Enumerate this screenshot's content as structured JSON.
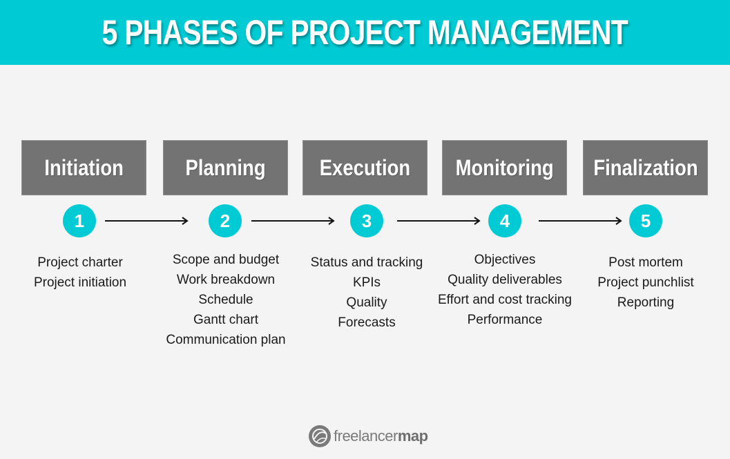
{
  "title": "5 PHASES OF PROJECT MANAGEMENT",
  "colors": {
    "accent": "#00cbd4",
    "box": "#737373",
    "background": "#f4f4f4"
  },
  "phases": [
    {
      "name": "Initiation",
      "number": "1",
      "items": [
        "Project charter",
        "Project initiation"
      ]
    },
    {
      "name": "Planning",
      "number": "2",
      "items": [
        "Scope and budget",
        "Work breakdown",
        "Schedule",
        "Gantt chart",
        "Communication plan"
      ]
    },
    {
      "name": "Execution",
      "number": "3",
      "items": [
        "Status and tracking",
        "KPIs",
        "Quality",
        "Forecasts"
      ]
    },
    {
      "name": "Monitoring",
      "number": "4",
      "items": [
        "Objectives",
        "Quality deliverables",
        "Effort and cost tracking",
        "Performance"
      ]
    },
    {
      "name": "Finalization",
      "number": "5",
      "items": [
        "Post mortem",
        "Project punchlist",
        "Reporting"
      ]
    }
  ],
  "logo": {
    "light": "freelancer",
    "bold": "map",
    "icon": "freelancermap-globe-icon"
  }
}
